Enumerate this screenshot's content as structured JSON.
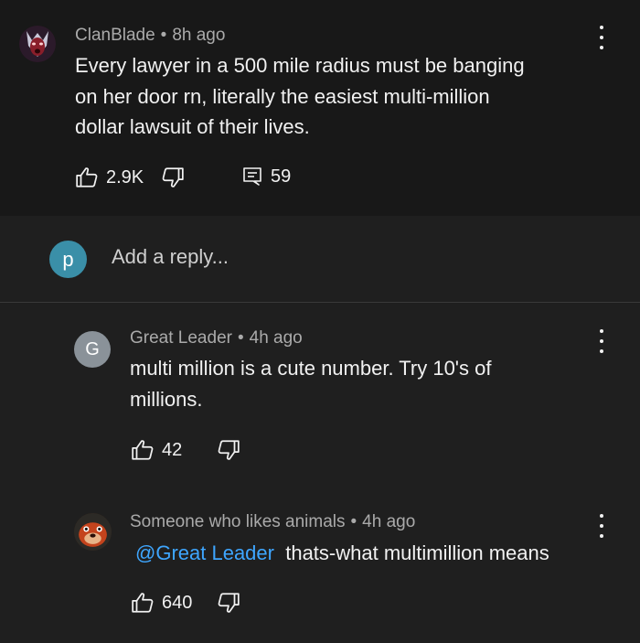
{
  "top_comment": {
    "author": "ClanBlade",
    "time": "8h ago",
    "text_lines": [
      "Every lawyer in a 500 mile radius must be banging",
      "on her door rn, literally the easiest multi-million",
      "dollar lawsuit of their lives."
    ],
    "likes": "2.9K",
    "replies": "59"
  },
  "reply_bar": {
    "avatar_letter": "p",
    "placeholder": "Add a reply...",
    "avatar_color": "#3a8fa8"
  },
  "replies": [
    {
      "author": "Great Leader",
      "time": "4h ago",
      "avatar_letter": "G",
      "avatar_color": "#8a9299",
      "text_lines": [
        "multi million is a cute number. Try 10's of",
        "millions."
      ],
      "likes": "42"
    },
    {
      "author": "Someone who likes animals",
      "time": "4h ago",
      "mention": "@Great Leader",
      "text": "thats-what multimillion means",
      "likes": "640"
    }
  ],
  "separator": "•",
  "colors": {
    "background": "#1f1f1f",
    "top_comment_bg": "#181818",
    "meta_text": "#aaaaaa",
    "mention": "#3ea6ff"
  }
}
